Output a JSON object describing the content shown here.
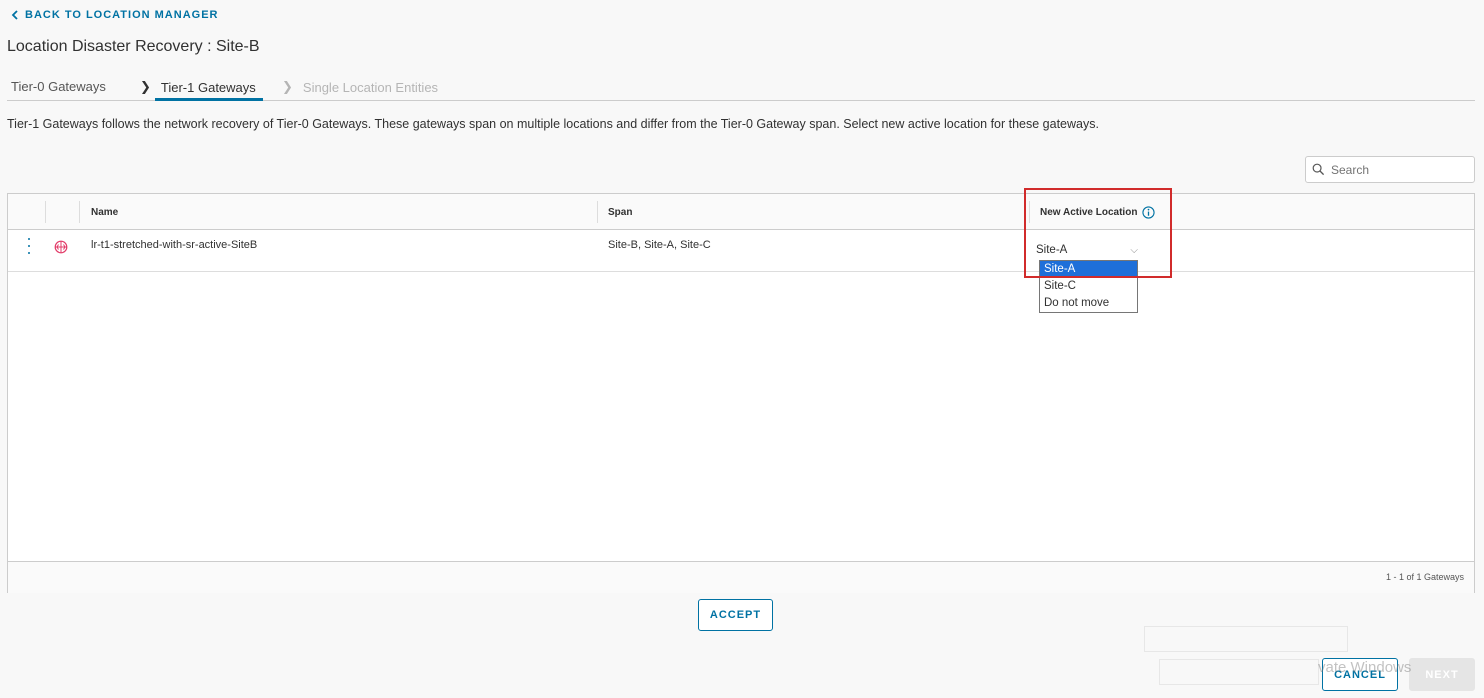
{
  "nav": {
    "back_label": "BACK TO LOCATION MANAGER"
  },
  "page": {
    "title": "Location Disaster Recovery : Site-B"
  },
  "steps": [
    {
      "label": "Tier-0 Gateways"
    },
    {
      "label": "Tier-1 Gateways"
    },
    {
      "label": "Single Location Entities"
    }
  ],
  "description": "Tier-1 Gateways follows the network recovery of Tier-0 Gateways. These gateways span on multiple locations and differ from the Tier-0 Gateway span. Select new active location for these gateways.",
  "search": {
    "placeholder": "Search",
    "icon": "search-icon"
  },
  "table": {
    "columns": {
      "name": "Name",
      "span": "Span",
      "new_active_location": "New Active Location"
    },
    "rows": [
      {
        "name": "lr-t1-stretched-with-sr-active-SiteB",
        "span": "Site-B, Site-A, Site-C",
        "new_active_location": "Site-A",
        "icon": "gateway-icon"
      }
    ],
    "dropdown_options": [
      "Site-A",
      "Site-C",
      "Do not move"
    ],
    "selected_option": "Site-A",
    "footer": "1 - 1 of 1 Gateways"
  },
  "buttons": {
    "accept": "ACCEPT",
    "cancel": "CANCEL",
    "next": "NEXT"
  },
  "watermark": "vate Windows",
  "colors": {
    "accent": "#0072a3",
    "highlight": "#d12b2b",
    "selected_option": "#1e6fd9",
    "gateway_icon": "#e23d6a"
  }
}
